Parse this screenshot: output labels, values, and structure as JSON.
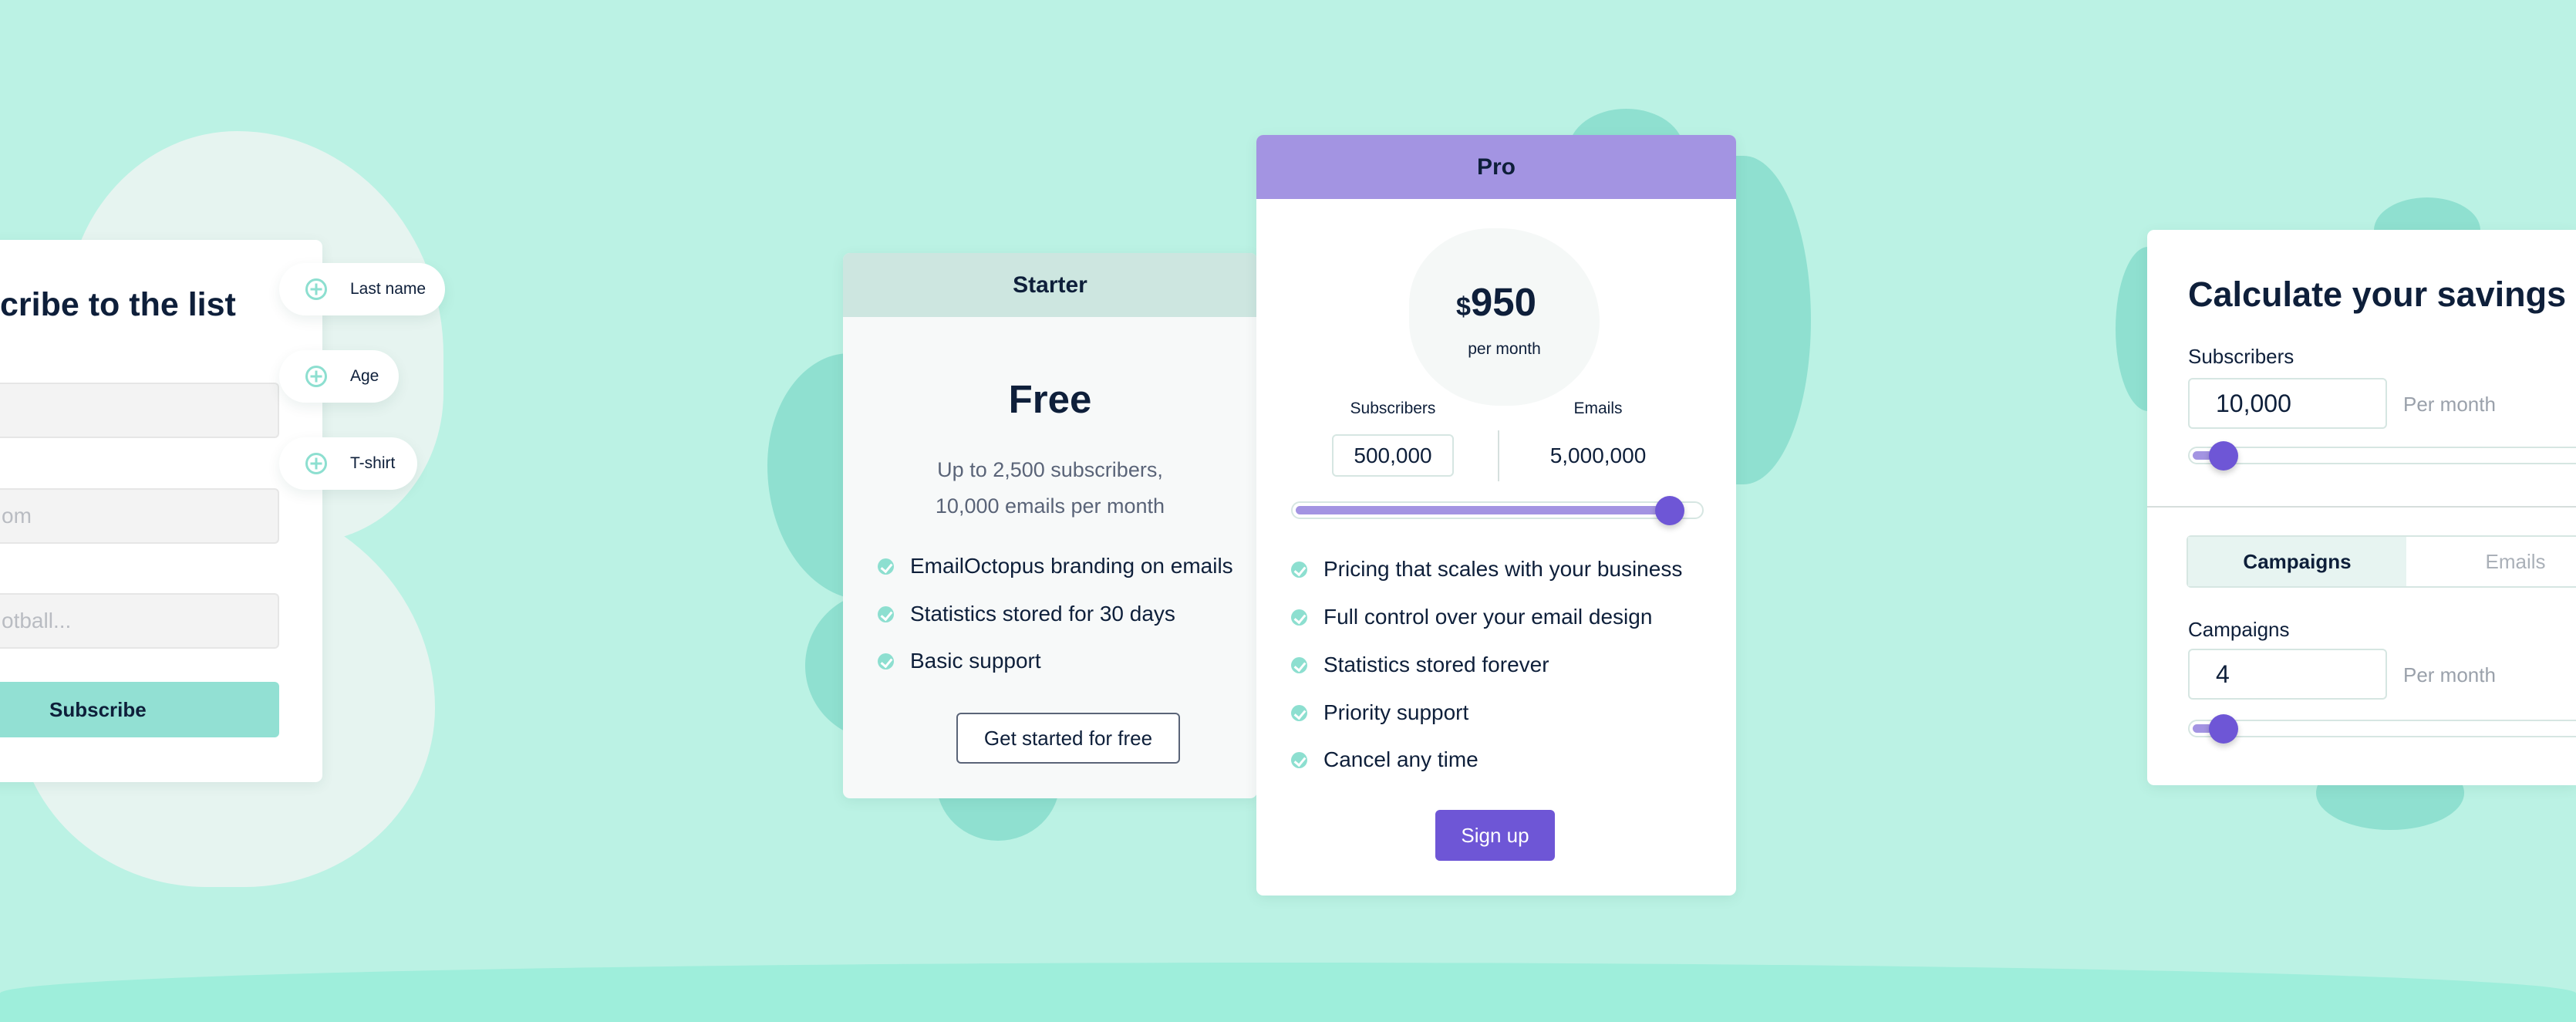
{
  "colors": {
    "background": "#bbf2e4",
    "accent_teal": "#8ddfd0",
    "accent_purple": "#6e56d6",
    "pro_header": "#a394e2",
    "starter_header": "#cde6e0",
    "text": "#0e1f3a"
  },
  "subscribe_form": {
    "title": "cribe to the list",
    "fields": [
      {
        "placeholder": ""
      },
      {
        "placeholder": "om"
      },
      {
        "placeholder": "otball..."
      }
    ],
    "button": "Subscribe",
    "add_field_pills": [
      "Last name",
      "Age",
      "T-shirt"
    ]
  },
  "starter": {
    "header": "Starter",
    "price": "Free",
    "desc_line1": "Up to 2,500 subscribers,",
    "desc_line2": "10,000 emails per month",
    "features": [
      "EmailOctopus branding on emails",
      "Statistics stored for 30 days",
      "Basic support"
    ],
    "button": "Get started for free"
  },
  "pro": {
    "header": "Pro",
    "currency": "$",
    "price": "950",
    "period": "per month",
    "subscribers_label": "Subscribers",
    "subscribers_value": "500,000",
    "emails_label": "Emails",
    "emails_value": "5,000,000",
    "slider_percent": 95,
    "features": [
      "Pricing that scales with your business",
      "Full control over your email design",
      "Statistics stored forever",
      "Priority support",
      "Cancel any time"
    ],
    "button": "Sign up"
  },
  "calculator": {
    "title": "Calculate your savings",
    "subscribers_label": "Subscribers",
    "subscribers_value": "10,000",
    "per_month": "Per month",
    "subscribers_slider_percent": 3,
    "tabs": [
      {
        "label": "Campaigns",
        "active": true
      },
      {
        "label": "Emails",
        "active": false
      }
    ],
    "campaigns_label": "Campaigns",
    "campaigns_value": "4",
    "campaigns_slider_percent": 3
  }
}
